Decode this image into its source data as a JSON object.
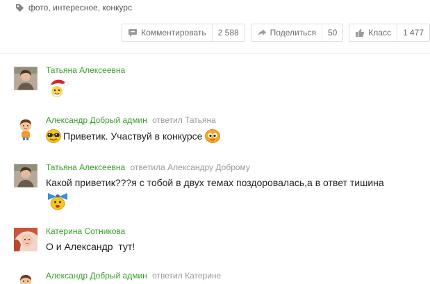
{
  "tags": {
    "icon": "tag-icon",
    "text": "фото, интересное, конкурс"
  },
  "actions": {
    "comment": {
      "icon": "comment-icon",
      "label": "Комментировать",
      "count": "2 588"
    },
    "share": {
      "icon": "share-icon",
      "label": "Поделиться",
      "count": "50"
    },
    "like": {
      "icon": "like-icon",
      "label": "Класс",
      "count": "1 477"
    }
  },
  "comments": [
    {
      "author": "Татьяна Алексеевна",
      "reply": "",
      "text": "",
      "avatar": "avatar-photo-woman",
      "sticker": "santa-smiley-icon"
    },
    {
      "author": "Александр Добрый админ",
      "reply": "ответил Татьяна",
      "text": "Приветик. Участвуй в конкурсе",
      "avatar": "avatar-boy-icon",
      "sticker": "glasses-smiley-icon"
    },
    {
      "author": "Татьяна Алексеевна",
      "reply": "ответила Александру Доброму",
      "text": "Какой приветик???я с тобой в двух темах поздоровалась,а в ответ тишина",
      "avatar": "avatar-photo-woman",
      "sticker": "bow-smiley-icon"
    },
    {
      "author": "Катерина Сотникова",
      "reply": "",
      "text": "О и Александр  тут!",
      "avatar": "avatar-photo-girl"
    },
    {
      "author": "Александр Добрый админ",
      "reply": "ответил Катерине",
      "text": "",
      "avatar": "avatar-boy-icon"
    }
  ],
  "colors": {
    "author": "#3a9a2b",
    "reply": "#999999",
    "button_border": "#dcdcdc",
    "button_text": "#6b6b6b"
  }
}
